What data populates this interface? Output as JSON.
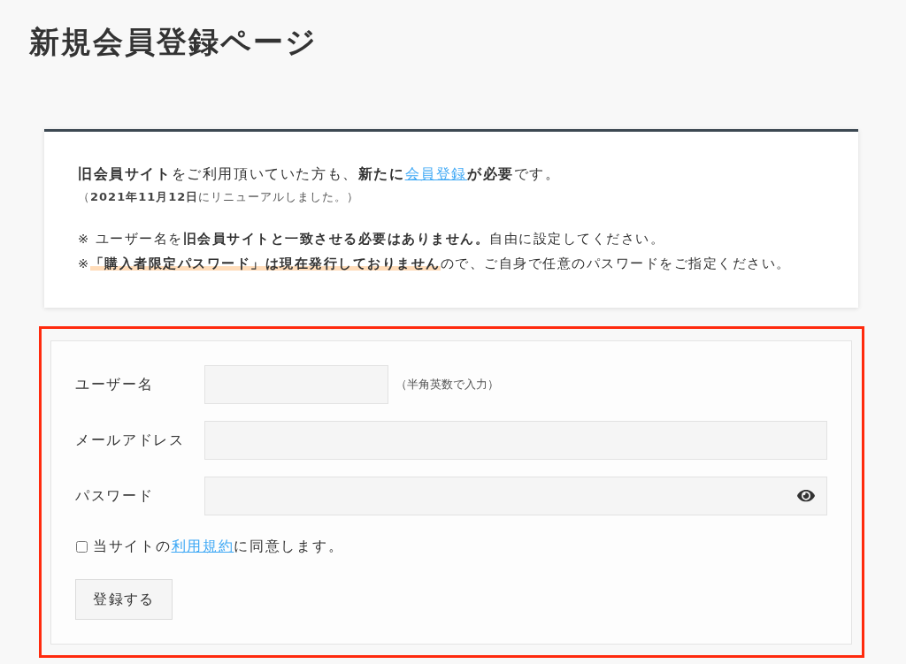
{
  "page_title": "新規会員登録ページ",
  "notice": {
    "lead": {
      "before": "**旧会員サイト**をご利用頂いていた方も、**新たに**",
      "link": "会員登録",
      "after": "**が必要**です。"
    },
    "renewal_note": "（**2021年11月12日**にリニューアルしました。）",
    "username_note": "※ ユーザー名を**旧会員サイトと一致させる必要はありません。**自由に設定してください。",
    "password_note": {
      "before": "※",
      "marked": "「購入者限定パスワード」は現在発行しておりません",
      "after": "ので、ご自身で任意のパスワードをご指定ください。"
    }
  },
  "form": {
    "fields": [
      {
        "kind": "username",
        "label": "ユーザー名",
        "hint": "（半角英数で入力）"
      },
      {
        "kind": "email",
        "label": "メールアドレス"
      },
      {
        "kind": "password",
        "label": "パスワード"
      }
    ],
    "agreement": {
      "checked": false,
      "before": "当サイトの",
      "link": "利用規約",
      "after": "に同意します。"
    },
    "submit": "登録する"
  }
}
